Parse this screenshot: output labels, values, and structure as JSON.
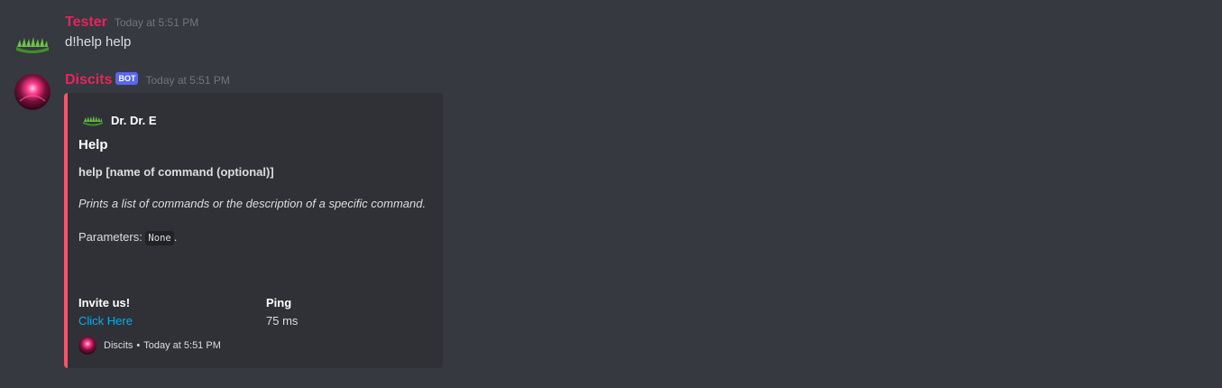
{
  "messages": [
    {
      "author": "Tester",
      "timestamp": "Today at 5:51 PM",
      "content": "d!help help",
      "avatar_icon": "grass-avatar-icon"
    },
    {
      "author": "Discits",
      "bot_tag": "BOT",
      "timestamp": "Today at 5:51 PM",
      "avatar_icon": "pink-orb-avatar-icon",
      "embed": {
        "accent_color": "#f0566c",
        "author_name": "Dr. Dr. E",
        "author_icon": "grass-icon",
        "title": "Help",
        "usage": "help [name of command (optional)]",
        "summary": "Prints a list of commands or the description of a specific command.",
        "params_label": "Parameters: ",
        "params_value": "None",
        "params_suffix": ".",
        "fields": [
          {
            "name": "Invite us!",
            "value": "Click Here",
            "is_link": true
          },
          {
            "name": "Ping",
            "value": "75 ms",
            "is_link": false
          }
        ],
        "footer": {
          "icon": "pink-orb-icon",
          "name": "Discits",
          "separator": "•",
          "timestamp": "Today at 5:51 PM"
        }
      }
    }
  ],
  "colors": {
    "background": "#36393f",
    "embed_background": "#2f3136",
    "author_color": "#e8235d",
    "link_color": "#00aff4",
    "bot_tag_color": "#5865f2"
  }
}
